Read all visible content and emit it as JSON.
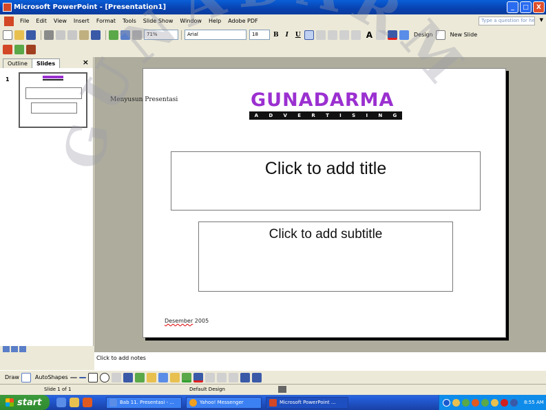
{
  "window": {
    "title": "Microsoft PowerPoint - [Presentation1]",
    "buttons": [
      "_",
      "□",
      "X"
    ]
  },
  "menu": {
    "items": [
      "File",
      "Edit",
      "View",
      "Insert",
      "Format",
      "Tools",
      "Slide Show",
      "Window",
      "Help",
      "Adobe PDF"
    ],
    "ask_placeholder": "Type a question for help"
  },
  "toolbar": {
    "zoom": "71%",
    "font": "Arial",
    "font_size": "18",
    "bold": "B",
    "italic": "I",
    "underline": "U",
    "font_a": "A",
    "design_label": "Design",
    "new_slide_label": "New Slide"
  },
  "panes": {
    "tabs": [
      "Outline",
      "Slides"
    ],
    "close": "×",
    "slide_number": "1"
  },
  "slide": {
    "caption": "Menyusun Presentasi",
    "logo_word": "GUNADARMA",
    "logo_letters": [
      "A",
      "D",
      "V",
      "E",
      "R",
      "T",
      "I",
      "S",
      "I",
      "N",
      "G"
    ],
    "title_placeholder": "Click to add title",
    "subtitle_placeholder": "Click to add subtitle",
    "date_word": "Desember",
    "date_year": " 2005"
  },
  "notes": {
    "placeholder": "Click to add notes"
  },
  "drawbar": {
    "draw_label": "Draw",
    "autoshapes_label": "AutoShapes"
  },
  "status": {
    "slide": "Slide 1 of 1",
    "design": "Default Design"
  },
  "taskbar": {
    "start": "start",
    "tasks": [
      {
        "label": "Bab 11. Presentasi - ...",
        "color": "#5a8de8"
      },
      {
        "label": "Yahoo! Messenger",
        "color": "#f0a020"
      },
      {
        "label": "Microsoft PowerPoint ...",
        "color": "#d24726"
      }
    ],
    "clock": "8:55 AM"
  },
  "watermark": {
    "text": "GUNADARMA",
    "color": "#9a9aa8"
  }
}
